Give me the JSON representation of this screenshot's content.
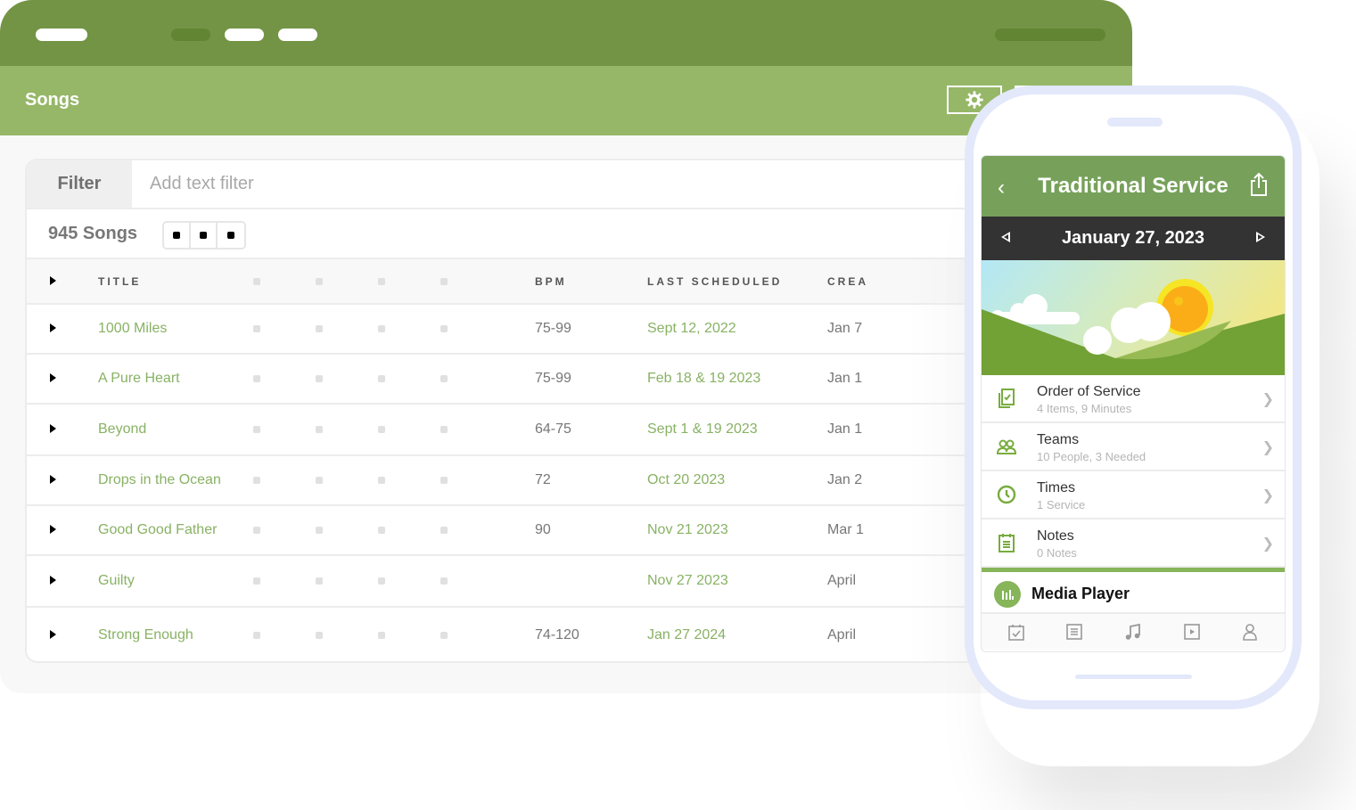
{
  "window": {
    "title": "Songs",
    "settings_icon": "gear-icon"
  },
  "filter": {
    "label": "Filter",
    "placeholder": "Add text filter",
    "value": ""
  },
  "list": {
    "count_label": "945 Songs",
    "view_toggle_count": 3
  },
  "table": {
    "columns": [
      "TITLE",
      "",
      "",
      "",
      "",
      "BPM",
      "LAST SCHEDULED",
      "CREA"
    ],
    "rows": [
      {
        "title": "1000 Miles",
        "bpm": "75-99",
        "last_scheduled": "Sept 12, 2022",
        "created": "Jan 7"
      },
      {
        "title": "A Pure Heart",
        "bpm": "75-99",
        "last_scheduled": "Feb 18 & 19 2023",
        "created": "Jan 1"
      },
      {
        "title": "Beyond",
        "bpm": "64-75",
        "last_scheduled": "Sept 1 & 19 2023",
        "created": "Jan 1"
      },
      {
        "title": "Drops in the Ocean",
        "bpm": "72",
        "last_scheduled": "Oct 20 2023",
        "created": "Jan 2"
      },
      {
        "title": "Good Good Father",
        "bpm": "90",
        "last_scheduled": "Nov 21 2023",
        "created": "Mar 1"
      },
      {
        "title": "Guilty",
        "bpm": "",
        "last_scheduled": "Nov 27 2023",
        "created": "April"
      },
      {
        "title": "Strong Enough",
        "bpm": "74-120",
        "last_scheduled": "Jan 27 2024",
        "created": "April"
      }
    ]
  },
  "phone": {
    "title": "Traditional Service",
    "date": "January 27, 2023",
    "menu": [
      {
        "label": "Order of Service",
        "sub": "4 Items, 9 Minutes",
        "icon": "order-of-service-icon"
      },
      {
        "label": "Teams",
        "sub": "10 People, 3 Needed",
        "icon": "teams-icon"
      },
      {
        "label": "Times",
        "sub": "1 Service",
        "icon": "clock-icon"
      },
      {
        "label": "Notes",
        "sub": "0 Notes",
        "icon": "notes-icon"
      }
    ],
    "media_label": "Media Player",
    "tabs": [
      "plans-icon",
      "list-icon",
      "music-icon",
      "media-icon",
      "profile-icon"
    ]
  },
  "colors": {
    "titlebar": "#739445",
    "header": "#96b768",
    "link_green": "#88b264",
    "app_green": "#77a15a",
    "date_bar": "#333333",
    "phone_frame": "#e3e8fb"
  }
}
